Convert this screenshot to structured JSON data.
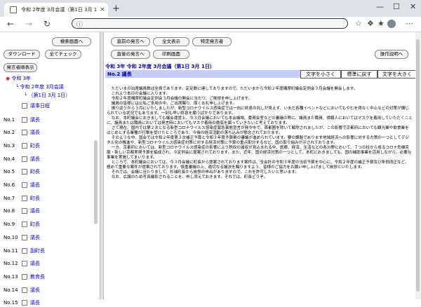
{
  "browser": {
    "tab_title": "令和 2年度 3月会議（第1日 3月 1",
    "tab_close": "×",
    "new_tab": "+",
    "address": ""
  },
  "left": {
    "search_top_button": "検索画面へ",
    "download_button": "ダウンロード",
    "check_all_button": "全てチェック",
    "speaker_list_button": "発言者順表示",
    "tree": {
      "year": "令和 3年",
      "meeting": "令和 2年度 3月会議",
      "day": "（第1日 3月 1日）",
      "agenda": "議事日程"
    },
    "rows": [
      {
        "no": "No.1",
        "title": "議長"
      },
      {
        "no": "No.2",
        "title": "議長"
      },
      {
        "no": "No.3",
        "title": "町長"
      },
      {
        "no": "No.4",
        "title": "議長"
      },
      {
        "no": "No.5",
        "title": "町長"
      },
      {
        "no": "No.6",
        "title": "議長"
      },
      {
        "no": "No.7",
        "title": "町長"
      },
      {
        "no": "No.8",
        "title": "議長"
      },
      {
        "no": "No.9",
        "title": "町長"
      },
      {
        "no": "No.10",
        "title": "議長"
      },
      {
        "no": "No.11",
        "title": "副町長"
      },
      {
        "no": "No.12",
        "title": "議長"
      },
      {
        "no": "No.13",
        "title": "教育長"
      },
      {
        "no": "No.14",
        "title": "議長"
      },
      {
        "no": "No.15",
        "title": "議長"
      }
    ]
  },
  "right": {
    "prev_speech_button": "直前の発言へ",
    "all_text_button": "全文表示",
    "specific_speaker_button": "特定発言者",
    "next_speech_button": "直後の発言へ",
    "print_button": "印刷画面",
    "help_button": "操作説明へ",
    "meeting_title": "令和 3年 令和 2年度 3月会議（第1日 3月 1日）",
    "speaker": "No.2 議長",
    "font_smaller": "文字を小さく",
    "font_standard": "標準に戻す",
    "font_larger": "文字を大きく",
    "paragraphs": [
      "ただいまの出席議員数は全員であります。定足数に達しておりますので、ただいまから令和２年度構摩町議会定例会３月会議を開会します。",
      "これより本日の会議に入ります。",
      "令和２年度構摩町議会定例会３月会議の開会に当たり、ご挨拶を申し上げます。",
      "議員の皆様には公私ご多用の中、ご出席賜り、厚くお礼申し上げます。",
      "振り返りから３月にいたしましたが、新型コロナウイルス感染症では一向に終息の兆しが見えず、いまだ各種イベントなどにおいてもやむを得なく中止などの対策が講じられている状況でもあります。一刻も早い終息を願うばかりであります。",
      "なお、本町議会におきましても議会運営上、今３月会議においても本会議場、委員会室などの審議の際に、議員また職員、傍聴人においてはマスクを着用していただくことに、議員または職員においては発言時においてもマスク着用の徹底を図っていきたいと考えております。",
      "さて現在、国内では第２次となる新型コロナウイルス感染症緊急事態宣言が発令中で、首都圏を除いて解除されましたが、この影響で京都府においても観光業や飲食業をはじめとする業種が打撃を受けたところであり、今後の経済活動の落ち込みが懸念されております。",
      "そのような中、国会では令和２年度第３次補正予算と令和３年度予算案の審議が進められています。要の課題であります地域経済への影響に対する方策の一つとしてデジタル化の推進や、新型コロナウイルス感染症対策に対する経済対策に予算の重点配分するなど、国の取り組みが示されております。",
      "一方、京都府においては、新型コロナウイルス感染症の影響により税収の減収が見込まれる中、医療、経済、生活などの各分野において、７つの柱から成るコロナ危機克服・新しい京都実現予算を編成され、今定例会に提案されております。また、近年、国の経済対策の一つとして、本町におきましても、国の補助事業を活用しながら、必要な事業を実施してまいります。",
      "ところで、本町議会においては、今３月会議に町長から提案されております案件は、全会計の令和３年度の当初予算を中心に、令和２年度の補正予算及び条例改正など、極めて重要な案件が提案されております。慎重審議の上、適切なる議決を賜りますよう、皆様のご協力をお願い申し上げまして挨拶といたします。",
      "それでは、会議に当たりまして、杉浦町長から挨拶の申出がありますので、これを許可したいと思います。",
      "なお、広報のため写真撮影されることを、申し添えておきます。それでは、町長どうぞ。"
    ]
  }
}
